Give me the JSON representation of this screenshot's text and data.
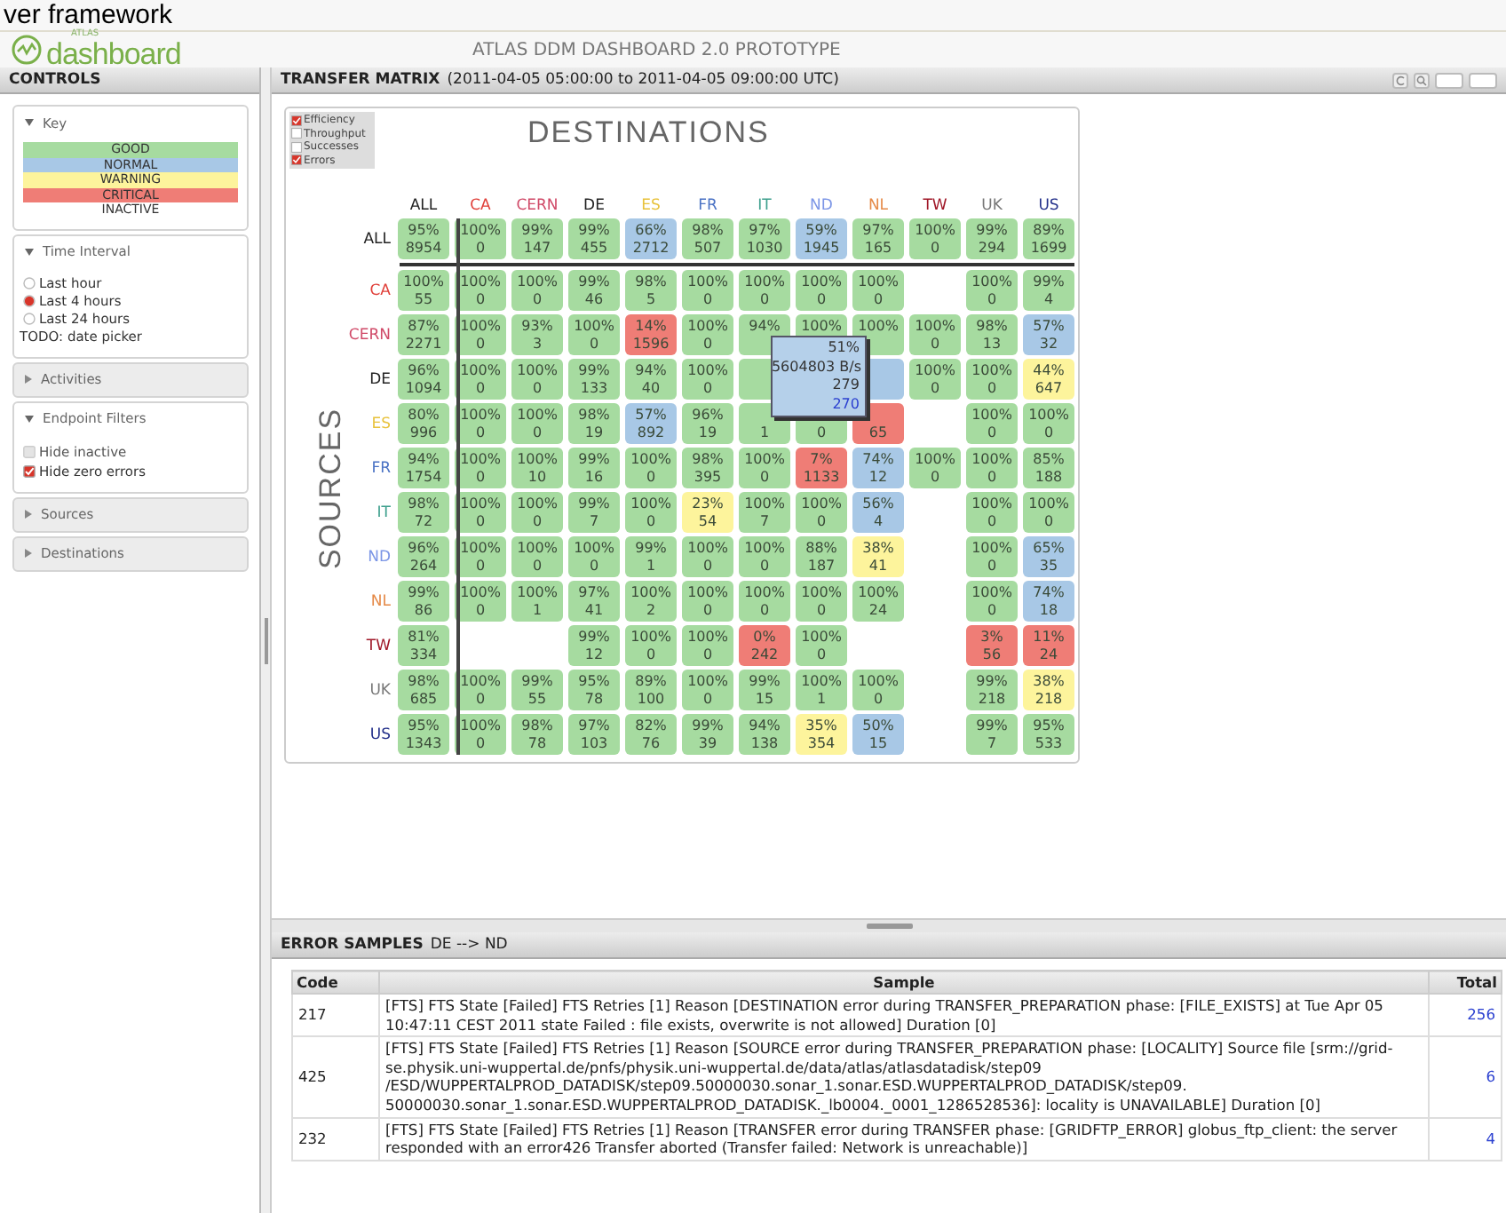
{
  "slide_heading": "ver framework",
  "logo": {
    "small": "ATLAS",
    "text": "dashboard"
  },
  "app_title": "ATLAS DDM DASHBOARD 2.0 PROTOTYPE",
  "controls": {
    "title": "CONTROLS",
    "sections": [
      {
        "kind": "key",
        "title": "Key",
        "expanded": true,
        "items": [
          {
            "label": "GOOD",
            "color": "#a6dba0"
          },
          {
            "label": "NORMAL",
            "color": "#a8c8e6"
          },
          {
            "label": "WARNING",
            "color": "#fdf49c"
          },
          {
            "label": "CRITICAL",
            "color": "#ef7d76"
          },
          {
            "label": "INACTIVE",
            "color": "#ffffff"
          }
        ]
      },
      {
        "kind": "radios",
        "title": "Time Interval",
        "expanded": true,
        "items": [
          {
            "label": "Last hour",
            "selected": false
          },
          {
            "label": "Last 4 hours",
            "selected": true
          },
          {
            "label": "Last 24 hours",
            "selected": false
          }
        ],
        "note": "TODO: date picker"
      },
      {
        "title": "Activities",
        "expanded": false
      },
      {
        "kind": "checks",
        "title": "Endpoint Filters",
        "expanded": true,
        "items": [
          {
            "label": "Hide inactive",
            "checked": false,
            "disabled": true
          },
          {
            "label": "Hide zero errors",
            "checked": true,
            "disabled": false
          }
        ]
      },
      {
        "title": "Sources",
        "expanded": false
      },
      {
        "title": "Destinations",
        "expanded": false
      }
    ]
  },
  "matrix": {
    "title": "TRANSFER MATRIX",
    "range": "(2011-04-05 05:00:00 to 2011-04-05 09:00:00 UTC)",
    "options": [
      {
        "label": "Efficiency",
        "checked": true
      },
      {
        "label": "Throughput",
        "checked": false
      },
      {
        "label": "Successes",
        "checked": false
      },
      {
        "label": "Errors",
        "checked": true
      }
    ],
    "axis_top": "DESTINATIONS",
    "axis_side": "SOURCES",
    "columns": [
      {
        "label": "ALL",
        "color": "#222222"
      },
      {
        "label": "CA",
        "color": "#e0403a"
      },
      {
        "label": "CERN",
        "color": "#d04a68"
      },
      {
        "label": "DE",
        "color": "#222222"
      },
      {
        "label": "ES",
        "color": "#e8c23c"
      },
      {
        "label": "FR",
        "color": "#4a72c4"
      },
      {
        "label": "IT",
        "color": "#3fa08e"
      },
      {
        "label": "ND",
        "color": "#7c96e6"
      },
      {
        "label": "NL",
        "color": "#e58a48"
      },
      {
        "label": "TW",
        "color": "#a01828"
      },
      {
        "label": "UK",
        "color": "#777777"
      },
      {
        "label": "US",
        "color": "#23308a"
      }
    ],
    "rows": [
      {
        "label": "ALL",
        "color": "#222222",
        "cells": [
          {
            "kind": "good",
            "pct": "95%",
            "count": "8954"
          },
          {
            "kind": "good",
            "pct": "100%",
            "count": "0"
          },
          {
            "kind": "good",
            "pct": "99%",
            "count": "147"
          },
          {
            "kind": "good",
            "pct": "99%",
            "count": "455"
          },
          {
            "kind": "normal",
            "pct": "66%",
            "count": "2712"
          },
          {
            "kind": "good",
            "pct": "98%",
            "count": "507"
          },
          {
            "kind": "good",
            "pct": "97%",
            "count": "1030"
          },
          {
            "kind": "normal",
            "pct": "59%",
            "count": "1945"
          },
          {
            "kind": "good",
            "pct": "97%",
            "count": "165"
          },
          {
            "kind": "good",
            "pct": "100%",
            "count": "0"
          },
          {
            "kind": "good",
            "pct": "99%",
            "count": "294"
          },
          {
            "kind": "good",
            "pct": "89%",
            "count": "1699"
          }
        ]
      },
      {
        "label": "CA",
        "color": "#e0403a",
        "cells": [
          {
            "kind": "good",
            "pct": "100%",
            "count": "55"
          },
          {
            "kind": "good",
            "pct": "100%",
            "count": "0"
          },
          {
            "kind": "good",
            "pct": "100%",
            "count": "0"
          },
          {
            "kind": "good",
            "pct": "99%",
            "count": "46"
          },
          {
            "kind": "good",
            "pct": "98%",
            "count": "5"
          },
          {
            "kind": "good",
            "pct": "100%",
            "count": "0"
          },
          {
            "kind": "good",
            "pct": "100%",
            "count": "0"
          },
          {
            "kind": "good",
            "pct": "100%",
            "count": "0"
          },
          {
            "kind": "good",
            "pct": "100%",
            "count": "0"
          },
          {
            "kind": "empty"
          },
          {
            "kind": "good",
            "pct": "100%",
            "count": "0"
          },
          {
            "kind": "good",
            "pct": "99%",
            "count": "4"
          }
        ]
      },
      {
        "label": "CERN",
        "color": "#d04a68",
        "cells": [
          {
            "kind": "good",
            "pct": "87%",
            "count": "2271"
          },
          {
            "kind": "good",
            "pct": "100%",
            "count": "0"
          },
          {
            "kind": "good",
            "pct": "93%",
            "count": "3"
          },
          {
            "kind": "good",
            "pct": "100%",
            "count": "0"
          },
          {
            "kind": "critical",
            "pct": "14%",
            "count": "1596"
          },
          {
            "kind": "good",
            "pct": "100%",
            "count": "0"
          },
          {
            "kind": "good",
            "pct": "94%"
          },
          {
            "kind": "good",
            "pct": "100%"
          },
          {
            "kind": "good",
            "pct": "100%"
          },
          {
            "kind": "good",
            "pct": "100%",
            "count": "0"
          },
          {
            "kind": "good",
            "pct": "98%",
            "count": "13"
          },
          {
            "kind": "normal",
            "pct": "57%",
            "count": "32"
          }
        ]
      },
      {
        "label": "DE",
        "color": "#222222",
        "cells": [
          {
            "kind": "good",
            "pct": "96%",
            "count": "1094"
          },
          {
            "kind": "good",
            "pct": "100%",
            "count": "0"
          },
          {
            "kind": "good",
            "pct": "100%",
            "count": "0"
          },
          {
            "kind": "good",
            "pct": "99%",
            "count": "133"
          },
          {
            "kind": "good",
            "pct": "94%",
            "count": "40"
          },
          {
            "kind": "good",
            "pct": "100%",
            "count": "0"
          },
          {
            "kind": "good"
          },
          {
            "kind": "normal"
          },
          {
            "kind": "normal"
          },
          {
            "kind": "good",
            "pct": "100%",
            "count": "0"
          },
          {
            "kind": "good",
            "pct": "100%",
            "count": "0"
          },
          {
            "kind": "warning",
            "pct": "44%",
            "count": "647"
          }
        ]
      },
      {
        "label": "ES",
        "color": "#e8c23c",
        "cells": [
          {
            "kind": "good",
            "pct": "80%",
            "count": "996"
          },
          {
            "kind": "good",
            "pct": "100%",
            "count": "0"
          },
          {
            "kind": "good",
            "pct": "100%",
            "count": "0"
          },
          {
            "kind": "good",
            "pct": "98%",
            "count": "19"
          },
          {
            "kind": "normal",
            "pct": "57%",
            "count": "892"
          },
          {
            "kind": "good",
            "pct": "96%",
            "count": "19"
          },
          {
            "kind": "good",
            "count": "1"
          },
          {
            "kind": "good",
            "count": "0"
          },
          {
            "kind": "critical",
            "count": "65"
          },
          {
            "kind": "empty"
          },
          {
            "kind": "good",
            "pct": "100%",
            "count": "0"
          },
          {
            "kind": "good",
            "pct": "100%",
            "count": "0"
          }
        ]
      },
      {
        "label": "FR",
        "color": "#4a72c4",
        "cells": [
          {
            "kind": "good",
            "pct": "94%",
            "count": "1754"
          },
          {
            "kind": "good",
            "pct": "100%",
            "count": "0"
          },
          {
            "kind": "good",
            "pct": "100%",
            "count": "10"
          },
          {
            "kind": "good",
            "pct": "99%",
            "count": "16"
          },
          {
            "kind": "good",
            "pct": "100%",
            "count": "0"
          },
          {
            "kind": "good",
            "pct": "98%",
            "count": "395"
          },
          {
            "kind": "good",
            "pct": "100%",
            "count": "0"
          },
          {
            "kind": "critical",
            "pct": "7%",
            "count": "1133"
          },
          {
            "kind": "normal",
            "pct": "74%",
            "count": "12"
          },
          {
            "kind": "good",
            "pct": "100%",
            "count": "0"
          },
          {
            "kind": "good",
            "pct": "100%",
            "count": "0"
          },
          {
            "kind": "good",
            "pct": "85%",
            "count": "188"
          }
        ]
      },
      {
        "label": "IT",
        "color": "#3fa08e",
        "cells": [
          {
            "kind": "good",
            "pct": "98%",
            "count": "72"
          },
          {
            "kind": "good",
            "pct": "100%",
            "count": "0"
          },
          {
            "kind": "good",
            "pct": "100%",
            "count": "0"
          },
          {
            "kind": "good",
            "pct": "99%",
            "count": "7"
          },
          {
            "kind": "good",
            "pct": "100%",
            "count": "0"
          },
          {
            "kind": "warning",
            "pct": "23%",
            "count": "54"
          },
          {
            "kind": "good",
            "pct": "100%",
            "count": "7"
          },
          {
            "kind": "good",
            "pct": "100%",
            "count": "0"
          },
          {
            "kind": "normal",
            "pct": "56%",
            "count": "4"
          },
          {
            "kind": "empty"
          },
          {
            "kind": "good",
            "pct": "100%",
            "count": "0"
          },
          {
            "kind": "good",
            "pct": "100%",
            "count": "0"
          }
        ]
      },
      {
        "label": "ND",
        "color": "#7c96e6",
        "cells": [
          {
            "kind": "good",
            "pct": "96%",
            "count": "264"
          },
          {
            "kind": "good",
            "pct": "100%",
            "count": "0"
          },
          {
            "kind": "good",
            "pct": "100%",
            "count": "0"
          },
          {
            "kind": "good",
            "pct": "100%",
            "count": "0"
          },
          {
            "kind": "good",
            "pct": "99%",
            "count": "1"
          },
          {
            "kind": "good",
            "pct": "100%",
            "count": "0"
          },
          {
            "kind": "good",
            "pct": "100%",
            "count": "0"
          },
          {
            "kind": "good",
            "pct": "88%",
            "count": "187"
          },
          {
            "kind": "warning",
            "pct": "38%",
            "count": "41"
          },
          {
            "kind": "empty"
          },
          {
            "kind": "good",
            "pct": "100%",
            "count": "0"
          },
          {
            "kind": "normal",
            "pct": "65%",
            "count": "35"
          }
        ]
      },
      {
        "label": "NL",
        "color": "#e58a48",
        "cells": [
          {
            "kind": "good",
            "pct": "99%",
            "count": "86"
          },
          {
            "kind": "good",
            "pct": "100%",
            "count": "0"
          },
          {
            "kind": "good",
            "pct": "100%",
            "count": "1"
          },
          {
            "kind": "good",
            "pct": "97%",
            "count": "41"
          },
          {
            "kind": "good",
            "pct": "100%",
            "count": "2"
          },
          {
            "kind": "good",
            "pct": "100%",
            "count": "0"
          },
          {
            "kind": "good",
            "pct": "100%",
            "count": "0"
          },
          {
            "kind": "good",
            "pct": "100%",
            "count": "0"
          },
          {
            "kind": "good",
            "pct": "100%",
            "count": "24"
          },
          {
            "kind": "empty"
          },
          {
            "kind": "good",
            "pct": "100%",
            "count": "0"
          },
          {
            "kind": "normal",
            "pct": "74%",
            "count": "18"
          }
        ]
      },
      {
        "label": "TW",
        "color": "#a01828",
        "cells": [
          {
            "kind": "good",
            "pct": "81%",
            "count": "334"
          },
          {
            "kind": "empty"
          },
          {
            "kind": "empty"
          },
          {
            "kind": "good",
            "pct": "99%",
            "count": "12"
          },
          {
            "kind": "good",
            "pct": "100%",
            "count": "0"
          },
          {
            "kind": "good",
            "pct": "100%",
            "count": "0"
          },
          {
            "kind": "critical",
            "pct": "0%",
            "count": "242"
          },
          {
            "kind": "good",
            "pct": "100%",
            "count": "0"
          },
          {
            "kind": "empty"
          },
          {
            "kind": "empty"
          },
          {
            "kind": "critical",
            "pct": "3%",
            "count": "56"
          },
          {
            "kind": "critical",
            "pct": "11%",
            "count": "24"
          }
        ]
      },
      {
        "label": "UK",
        "color": "#777777",
        "cells": [
          {
            "kind": "good",
            "pct": "98%",
            "count": "685"
          },
          {
            "kind": "good",
            "pct": "100%",
            "count": "0"
          },
          {
            "kind": "good",
            "pct": "99%",
            "count": "55"
          },
          {
            "kind": "good",
            "pct": "95%",
            "count": "78"
          },
          {
            "kind": "good",
            "pct": "89%",
            "count": "100"
          },
          {
            "kind": "good",
            "pct": "100%",
            "count": "0"
          },
          {
            "kind": "good",
            "pct": "99%",
            "count": "15"
          },
          {
            "kind": "good",
            "pct": "100%",
            "count": "1"
          },
          {
            "kind": "good",
            "pct": "100%",
            "count": "0"
          },
          {
            "kind": "empty"
          },
          {
            "kind": "good",
            "pct": "99%",
            "count": "218"
          },
          {
            "kind": "warning",
            "pct": "38%",
            "count": "218"
          }
        ]
      },
      {
        "label": "US",
        "color": "#23308a",
        "cells": [
          {
            "kind": "good",
            "pct": "95%",
            "count": "1343"
          },
          {
            "kind": "good",
            "pct": "100%",
            "count": "0"
          },
          {
            "kind": "good",
            "pct": "98%",
            "count": "78"
          },
          {
            "kind": "good",
            "pct": "97%",
            "count": "103"
          },
          {
            "kind": "good",
            "pct": "82%",
            "count": "76"
          },
          {
            "kind": "good",
            "pct": "99%",
            "count": "39"
          },
          {
            "kind": "good",
            "pct": "94%",
            "count": "138"
          },
          {
            "kind": "warning",
            "pct": "35%",
            "count": "354"
          },
          {
            "kind": "normal",
            "pct": "50%",
            "count": "15"
          },
          {
            "kind": "empty"
          },
          {
            "kind": "good",
            "pct": "99%",
            "count": "7"
          },
          {
            "kind": "good",
            "pct": "95%",
            "count": "533"
          }
        ]
      }
    ],
    "tooltip": {
      "efficiency": "51%",
      "throughput": "5604803 B/s",
      "successes": "279",
      "errors": "270"
    }
  },
  "errors": {
    "title": "ERROR SAMPLES",
    "pair": "DE --> ND",
    "columns": [
      "Code",
      "Sample",
      "Total"
    ],
    "rows": [
      {
        "code": "217",
        "sample": "[FTS] FTS State [Failed] FTS Retries [1] Reason [DESTINATION error during TRANSFER_PREPARATION phase: [FILE_EXISTS] at Tue Apr 05 10:47:11 CEST 2011 state Failed : file exists, overwrite is not allowed] Duration [0]",
        "total": "256"
      },
      {
        "code": "425",
        "sample": "[FTS] FTS State [Failed] FTS Retries [1] Reason [SOURCE error during TRANSFER_PREPARATION phase: [LOCALITY] Source file [srm://grid-se.physik.uni-wuppertal.de/pnfs/physik.uni-wuppertal.de/data/atlas/atlasdatadisk/step09 /ESD/WUPPERTALPROD_DATADISK/step09.50000030.sonar_1.sonar.ESD.WUPPERTALPROD_DATADISK/step09. 50000030.sonar_1.sonar.ESD.WUPPERTALPROD_DATADISK._lb0004._0001_1286528536]: locality is UNAVAILABLE] Duration [0]",
        "total": "6"
      },
      {
        "code": "232",
        "sample": "[FTS] FTS State [Failed] FTS Retries [1] Reason [TRANSFER error during TRANSFER phase: [GRIDFTP_ERROR] globus_ftp_client: the server responded with an error426 Transfer aborted (Transfer failed: Network is unreachable)]",
        "total": "4"
      }
    ]
  }
}
